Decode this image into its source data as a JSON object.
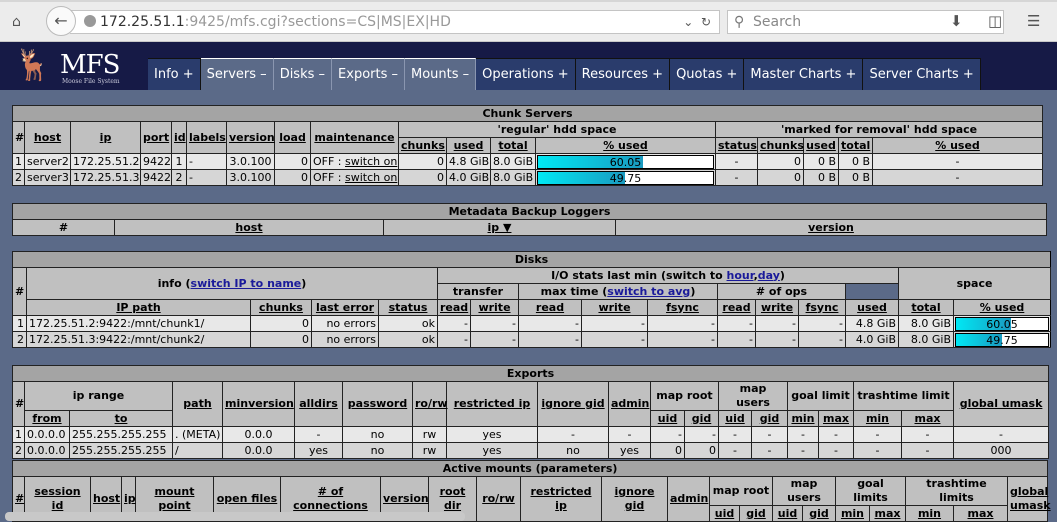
{
  "browser": {
    "url_host": "172.25.51.1",
    "url_rest": ":9425/mfs.cgi?sections=CS|MS|EX|HD",
    "search_placeholder": "Search",
    "icons": [
      "home-icon",
      "back-icon",
      "globe-icon",
      "dropdown-icon",
      "reload-icon",
      "search-icon",
      "download-icon",
      "sidebar-icon",
      "menu-icon"
    ]
  },
  "header": {
    "logo_text": "MFS",
    "logo_sub": "Moose File System",
    "tabs": [
      {
        "label": "Info +",
        "open": false
      },
      {
        "label": "Servers –",
        "open": true
      },
      {
        "label": "Disks –",
        "open": true
      },
      {
        "label": "Exports –",
        "open": true
      },
      {
        "label": "Mounts –",
        "open": true
      },
      {
        "label": "Operations +",
        "open": false
      },
      {
        "label": "Resources +",
        "open": false
      },
      {
        "label": "Quotas +",
        "open": false
      },
      {
        "label": "Master Charts +",
        "open": false
      },
      {
        "label": "Server Charts +",
        "open": false
      }
    ]
  },
  "colors": {
    "bar_start": "#00e8f4",
    "bar_end": "#1a9ac0",
    "page_bg": "#5b6a88",
    "header_bg": "#161a46"
  },
  "tables": {
    "chunk_servers": {
      "header": [
        [
          "Chunk Servers"
        ],
        [
          "#",
          "host",
          "ip",
          "port",
          "id",
          "labels",
          "version",
          "load",
          "maintenance",
          "'regular' hdd space",
          "'marked for removal' hdd space"
        ],
        [
          "chunks",
          "used",
          "total",
          "% used",
          "status",
          "chunks",
          "used",
          "total",
          "% used"
        ]
      ],
      "rows": [
        [
          "1",
          "server2",
          "172.25.51.2",
          "9422",
          "1",
          "-",
          "3.0.100",
          "0",
          "OFF : |switch on",
          "0",
          "4.8 GiB",
          "8.0 GiB",
          {
            "bar": 60.05
          },
          "-",
          "0",
          "0 B",
          "0 B",
          "-"
        ],
        [
          "2",
          "server3",
          "172.25.51.3",
          "9422",
          "2",
          "-",
          "3.0.100",
          "0",
          "OFF : |switch on",
          "0",
          "4.0 GiB",
          "8.0 GiB",
          {
            "bar": 49.75
          },
          "-",
          "0",
          "0 B",
          "0 B",
          "-"
        ]
      ]
    },
    "metadata_loggers": {
      "header": [
        [
          "Metadata Backup Loggers"
        ],
        [
          "#",
          "host",
          "ip ▼",
          "version"
        ]
      ],
      "rows": []
    },
    "disks": {
      "header": [
        [
          "Disks"
        ],
        [
          "#",
          [
            {
              "t": "info ("
            },
            {
              "t": "switch IP to name",
              "link": true
            },
            {
              "t": ")"
            }
          ],
          [
            {
              "t": "I/O stats last min (switch to "
            },
            {
              "t": "hour",
              "link": true
            },
            {
              "t": ","
            },
            {
              "t": "day",
              "link": true
            },
            {
              "t": ")"
            }
          ],
          "space"
        ],
        [
          "transfer",
          [
            {
              "t": "max time ("
            },
            {
              "t": "switch to avg",
              "link": true
            },
            {
              "t": ")"
            }
          ],
          "# of ops"
        ],
        [
          "IP path",
          "chunks",
          "last error",
          "status",
          "read",
          "write",
          "read",
          "write",
          "fsync",
          "read",
          "write",
          "fsync",
          "used",
          "total",
          "% used"
        ]
      ],
      "rows": [
        [
          "1",
          "172.25.51.2:9422:/mnt/chunk1/",
          "0",
          "no errors",
          "ok",
          "-",
          "-",
          "-",
          "-",
          "-",
          "-",
          "-",
          "-",
          "4.8 GiB",
          "8.0 GiB",
          {
            "bar": 60.05
          }
        ],
        [
          "2",
          "172.25.51.3:9422:/mnt/chunk2/",
          "0",
          "no errors",
          "ok",
          "-",
          "-",
          "-",
          "-",
          "-",
          "-",
          "-",
          "-",
          "4.0 GiB",
          "8.0 GiB",
          {
            "bar": 49.75
          }
        ]
      ]
    },
    "exports": {
      "header": [
        [
          "Exports"
        ],
        [
          "#",
          "ip range",
          "path",
          "minversion",
          "alldirs",
          "password",
          "ro/rw",
          "restricted ip",
          "ignore gid",
          "admin",
          "map root",
          "map users",
          "goal limit",
          "trashtime limit",
          "global umask"
        ],
        [
          "from",
          "to",
          "uid",
          "gid",
          "uid",
          "gid",
          "min",
          "max",
          "min",
          "max"
        ]
      ],
      "rows": [
        [
          "1",
          "0.0.0.0",
          "255.255.255.255",
          ". (META)",
          "0.0.0",
          "-",
          "no",
          "rw",
          "yes",
          "-",
          "-",
          "-",
          "-",
          "-",
          "-",
          "-",
          "-",
          "-",
          "-",
          "-"
        ],
        [
          "2",
          "0.0.0.0",
          "255.255.255.255",
          "/",
          "0.0.0",
          "yes",
          "no",
          "rw",
          "yes",
          "no",
          "yes",
          "0",
          "0",
          "-",
          "-",
          "-",
          "-",
          "-",
          "-",
          "000"
        ]
      ]
    },
    "active_mounts": {
      "header": [
        [
          "Active mounts (parameters)"
        ],
        [
          "#",
          "session id",
          "host",
          "ip",
          "mount point",
          "open files",
          "# of connections",
          "version",
          "root dir",
          "ro/rw",
          "restricted ip",
          "ignore gid",
          "admin",
          "map root",
          "map users",
          "goal limits",
          "trashtime limits",
          "global umask"
        ],
        [
          "uid",
          "gid",
          "uid",
          "gid",
          "min",
          "max",
          "min",
          "max"
        ]
      ],
      "rows": []
    }
  }
}
